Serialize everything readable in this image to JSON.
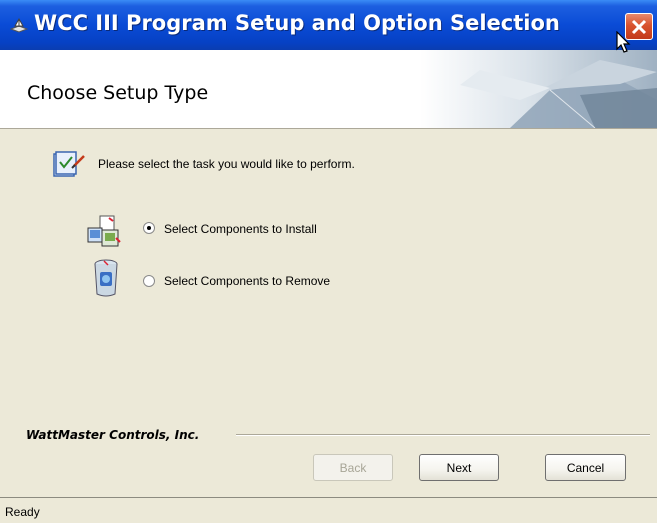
{
  "window": {
    "title": "WCC III Program Setup and Option Selection",
    "title_icon": "setup-disk-icon",
    "close_icon": "close-icon"
  },
  "header": {
    "title": "Choose Setup Type",
    "decoration": "open-box-graphic"
  },
  "content": {
    "prompt_icon": "checklist-icon",
    "prompt": "Please select the task you would like to perform.",
    "options": [
      {
        "label": "Select Components to Install",
        "selected": true,
        "icon": "install-components-icon"
      },
      {
        "label": "Select Components to Remove",
        "selected": false,
        "icon": "remove-components-icon"
      }
    ]
  },
  "footer": {
    "company": "WattMaster Controls, Inc.",
    "buttons": {
      "back": {
        "label": "Back",
        "enabled": false
      },
      "next": {
        "label": "Next",
        "enabled": true
      },
      "cancel": {
        "label": "Cancel",
        "enabled": true
      }
    }
  },
  "status": {
    "text": "Ready"
  },
  "colors": {
    "titlebar": "#0a4bd6",
    "close_button": "#d9532e",
    "dialog_background": "#ece9d8",
    "banner_background": "#ffffff"
  }
}
